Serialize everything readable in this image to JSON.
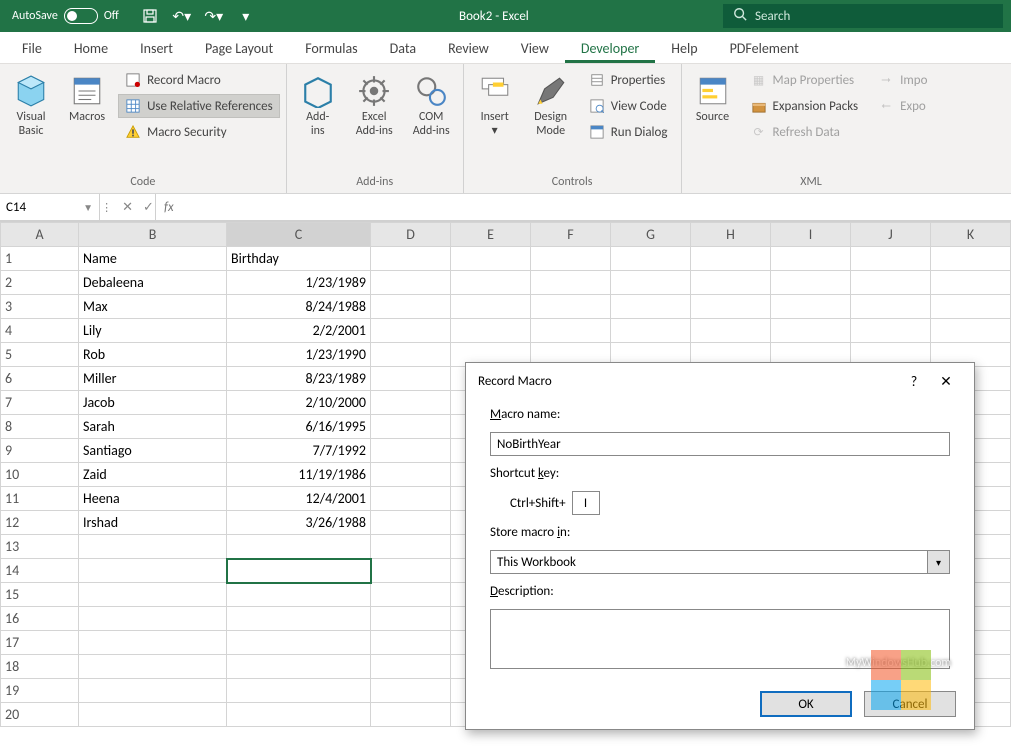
{
  "titlebar": {
    "autosave_label": "AutoSave",
    "autosave_state": "Off",
    "doc_title": "Book2  -  Excel",
    "search_placeholder": "Search"
  },
  "tabs": [
    "File",
    "Home",
    "Insert",
    "Page Layout",
    "Formulas",
    "Data",
    "Review",
    "View",
    "Developer",
    "Help",
    "PDFelement"
  ],
  "active_tab": "Developer",
  "ribbon": {
    "code": {
      "visual_basic": "Visual\nBasic",
      "macros": "Macros",
      "record_macro": "Record Macro",
      "use_relative": "Use Relative References",
      "macro_security": "Macro Security",
      "label": "Code"
    },
    "addins": {
      "addins": "Add-\nins",
      "excel_addins": "Excel\nAdd-ins",
      "com_addins": "COM\nAdd-ins",
      "label": "Add-ins"
    },
    "controls": {
      "insert": "Insert",
      "design_mode": "Design\nMode",
      "properties": "Properties",
      "view_code": "View Code",
      "run_dialog": "Run Dialog",
      "label": "Controls"
    },
    "xml": {
      "source": "Source",
      "map_properties": "Map Properties",
      "expansion_packs": "Expansion Packs",
      "refresh_data": "Refresh Data",
      "import": "Impo",
      "export": "Expo",
      "label": "XML"
    }
  },
  "formula_bar": {
    "name_box": "C14"
  },
  "columns": [
    "A",
    "B",
    "C",
    "D",
    "E",
    "F",
    "G",
    "H",
    "I",
    "J",
    "K"
  ],
  "rows": [
    {
      "n": 1,
      "B": "Name",
      "C": "Birthday",
      "Cr": false
    },
    {
      "n": 2,
      "B": "Debaleena",
      "C": "1/23/1989",
      "Cr": true
    },
    {
      "n": 3,
      "B": "Max",
      "C": "8/24/1988",
      "Cr": true
    },
    {
      "n": 4,
      "B": "Lily",
      "C": "2/2/2001",
      "Cr": true
    },
    {
      "n": 5,
      "B": "Rob",
      "C": "1/23/1990",
      "Cr": true
    },
    {
      "n": 6,
      "B": "Miller",
      "C": "8/23/1989",
      "Cr": true
    },
    {
      "n": 7,
      "B": "Jacob",
      "C": "2/10/2000",
      "Cr": true
    },
    {
      "n": 8,
      "B": "Sarah",
      "C": "6/16/1995",
      "Cr": true
    },
    {
      "n": 9,
      "B": "Santiago",
      "C": "7/7/1992",
      "Cr": true
    },
    {
      "n": 10,
      "B": "Zaid",
      "C": "11/19/1986",
      "Cr": true
    },
    {
      "n": 11,
      "B": "Heena",
      "C": "12/4/2001",
      "Cr": true
    },
    {
      "n": 12,
      "B": "Irshad",
      "C": "3/26/1988",
      "Cr": true
    },
    {
      "n": 13
    },
    {
      "n": 14
    },
    {
      "n": 15
    },
    {
      "n": 16
    },
    {
      "n": 17
    },
    {
      "n": 18
    },
    {
      "n": 19
    },
    {
      "n": 20
    }
  ],
  "selected_cell": "C14",
  "dialog": {
    "title": "Record Macro",
    "macro_name_label": "Macro name:",
    "macro_name_value": "NoBirthYear",
    "shortcut_label": "Shortcut key:",
    "shortcut_prefix": "Ctrl+Shift+",
    "shortcut_value": "I",
    "store_label": "Store macro in:",
    "store_value": "This Workbook",
    "description_label": "Description:",
    "ok": "OK",
    "cancel": "Cancel"
  },
  "watermark": "MyWindowsHub.com"
}
